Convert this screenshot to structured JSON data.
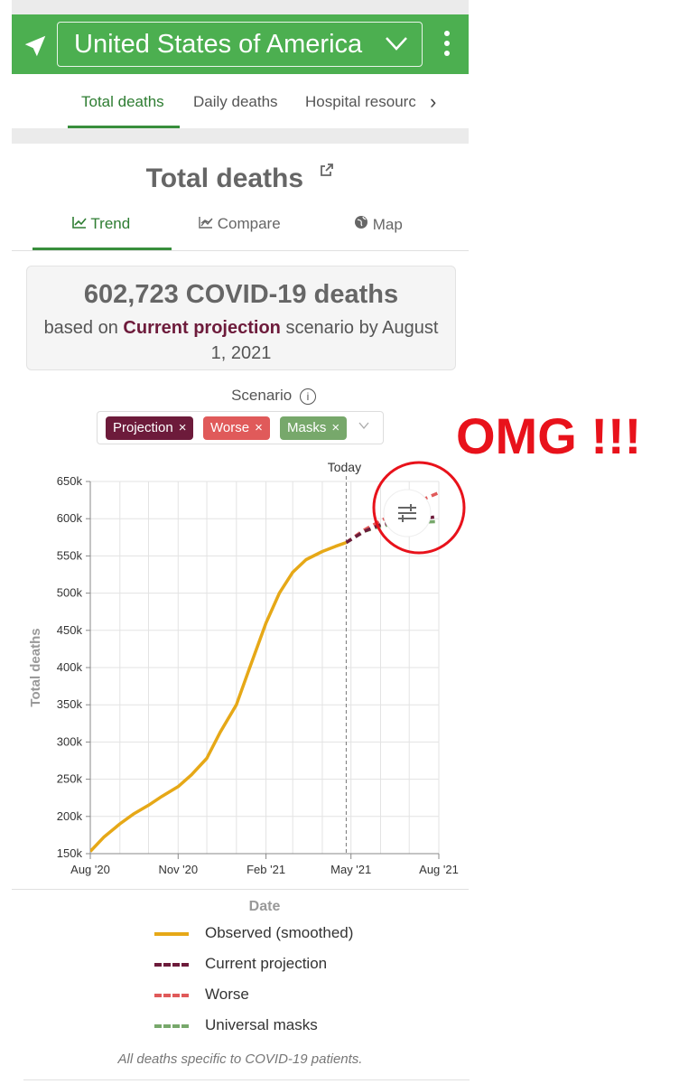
{
  "header": {
    "country": "United States of America",
    "accent_color": "#4caf50"
  },
  "tabs": [
    {
      "label": "Total deaths",
      "active": true
    },
    {
      "label": "Daily deaths",
      "active": false
    },
    {
      "label": "Hospital resourc",
      "active": false
    }
  ],
  "page": {
    "title": "Total deaths"
  },
  "subtabs": [
    {
      "label": "Trend",
      "icon": "line-chart-icon",
      "active": true
    },
    {
      "label": "Compare",
      "icon": "compare-chart-icon",
      "active": false
    },
    {
      "label": "Map",
      "icon": "globe-icon",
      "active": false
    }
  ],
  "summary": {
    "count": "602,723",
    "count_suffix": "COVID-19 deaths",
    "prefix": "based on",
    "scenario": "Current projection",
    "suffix": "scenario by August 1, 2021"
  },
  "scenario_filter": {
    "label": "Scenario",
    "chips": [
      {
        "label": "Projection",
        "color": "#6d1b3b"
      },
      {
        "label": "Worse",
        "color": "#e05a5a"
      },
      {
        "label": "Masks",
        "color": "#77a86b"
      }
    ]
  },
  "annotation": {
    "text": "OMG !!!",
    "color": "#e8121b"
  },
  "chart_data": {
    "type": "line",
    "xlabel": "Date",
    "ylabel": "Total deaths",
    "ylim": [
      150000,
      650000
    ],
    "x_ticks": [
      "Aug '20",
      "Nov '20",
      "Feb '21",
      "May '21",
      "Aug '21"
    ],
    "y_ticks": [
      "150k",
      "200k",
      "250k",
      "300k",
      "350k",
      "400k",
      "450k",
      "500k",
      "550k",
      "600k",
      "650k"
    ],
    "today_label": "Today",
    "today_date": "2021-04-26",
    "grid": true,
    "series": [
      {
        "name": "Observed (smoothed)",
        "color": "#e6a817",
        "style": "solid",
        "points": [
          [
            "2020-08-01",
            153000
          ],
          [
            "2020-08-15",
            172000
          ],
          [
            "2020-09-01",
            190000
          ],
          [
            "2020-09-15",
            203000
          ],
          [
            "2020-10-01",
            215000
          ],
          [
            "2020-10-15",
            227000
          ],
          [
            "2020-11-01",
            240000
          ],
          [
            "2020-11-15",
            256000
          ],
          [
            "2020-12-01",
            278000
          ],
          [
            "2020-12-15",
            313000
          ],
          [
            "2021-01-01",
            350000
          ],
          [
            "2021-01-15",
            400000
          ],
          [
            "2021-02-01",
            460000
          ],
          [
            "2021-02-15",
            500000
          ],
          [
            "2021-03-01",
            528000
          ],
          [
            "2021-03-15",
            545000
          ],
          [
            "2021-04-01",
            556000
          ],
          [
            "2021-04-15",
            563000
          ],
          [
            "2021-04-26",
            568000
          ]
        ]
      },
      {
        "name": "Current projection",
        "color": "#6d1b3b",
        "style": "dashed",
        "points": [
          [
            "2021-04-26",
            568000
          ],
          [
            "2021-05-15",
            583000
          ],
          [
            "2021-06-01",
            592000
          ],
          [
            "2021-07-01",
            598000
          ],
          [
            "2021-07-30",
            602723
          ]
        ]
      },
      {
        "name": "Worse",
        "color": "#e05a5a",
        "style": "dashed",
        "points": [
          [
            "2021-04-26",
            568000
          ],
          [
            "2021-05-15",
            585000
          ],
          [
            "2021-06-01",
            597000
          ],
          [
            "2021-07-01",
            618000
          ],
          [
            "2021-08-01",
            635000
          ]
        ]
      },
      {
        "name": "Universal masks",
        "color": "#77a86b",
        "style": "dashed",
        "points": [
          [
            "2021-04-26",
            568000
          ],
          [
            "2021-05-15",
            583000
          ],
          [
            "2021-06-01",
            590000
          ],
          [
            "2021-07-01",
            595000
          ],
          [
            "2021-07-30",
            596000
          ]
        ]
      }
    ]
  },
  "legend": [
    {
      "label": "Observed (smoothed)",
      "color": "#e6a817",
      "style": "solid"
    },
    {
      "label": "Current projection",
      "color": "#6d1b3b",
      "style": "dashed"
    },
    {
      "label": "Worse",
      "color": "#e05a5a",
      "style": "dashed"
    },
    {
      "label": "Universal masks",
      "color": "#77a86b",
      "style": "dashed"
    }
  ],
  "footnote": "All deaths specific to COVID-19 patients."
}
